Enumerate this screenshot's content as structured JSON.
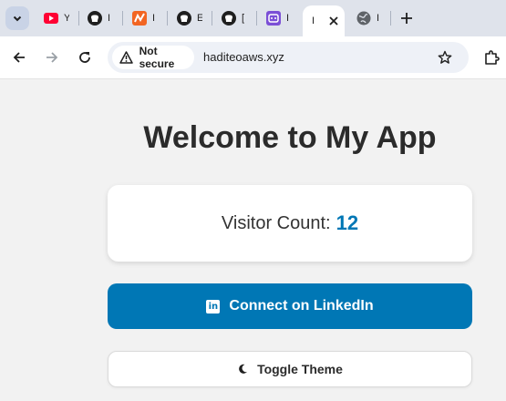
{
  "browser": {
    "tabs": [
      {
        "icon": "youtube-icon",
        "title": "Y"
      },
      {
        "icon": "github-icon",
        "title": "I"
      },
      {
        "icon": "orange-app-icon",
        "title": "I"
      },
      {
        "icon": "github-icon",
        "title": "E"
      },
      {
        "icon": "github-icon",
        "title": "["
      },
      {
        "icon": "purple-app-icon",
        "title": "I"
      },
      {
        "icon": "",
        "title": "I",
        "active": true
      },
      {
        "icon": "globe-icon",
        "title": "I"
      }
    ],
    "security_label": "Not secure",
    "url": "haditeoaws.xyz"
  },
  "page": {
    "title": "Welcome to My App",
    "visitor_label": "Visitor Count:",
    "visitor_count": "12",
    "linkedin_label": "Connect on LinkedIn",
    "theme_label": "Toggle Theme"
  },
  "colors": {
    "accent": "#0077b5",
    "tab_strip": "#dfe3eb",
    "page_background": "#f2f2f2"
  }
}
